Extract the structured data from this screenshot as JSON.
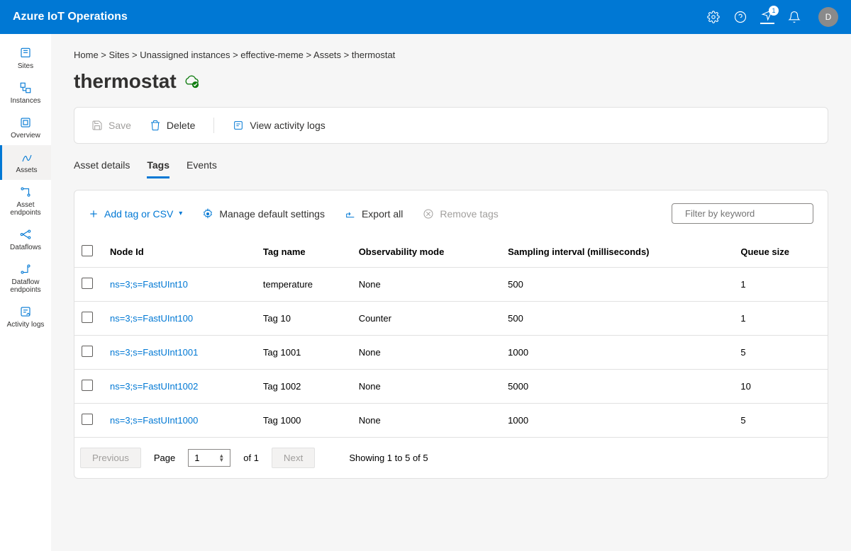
{
  "brand": "Azure IoT Operations",
  "feedbackBadge": "1",
  "avatar": "D",
  "sidebar": {
    "items": [
      {
        "label": "Sites"
      },
      {
        "label": "Instances"
      },
      {
        "label": "Overview"
      },
      {
        "label": "Assets"
      },
      {
        "label": "Asset endpoints"
      },
      {
        "label": "Dataflows"
      },
      {
        "label": "Dataflow endpoints"
      },
      {
        "label": "Activity logs"
      }
    ]
  },
  "breadcrumb": [
    "Home",
    "Sites",
    "Unassigned instances",
    "effective-meme",
    "Assets",
    "thermostat"
  ],
  "title": "thermostat",
  "toolbar": {
    "save": "Save",
    "delete": "Delete",
    "logs": "View activity logs"
  },
  "tabs": [
    "Asset details",
    "Tags",
    "Events"
  ],
  "actions": {
    "add": "Add tag or CSV",
    "manage": "Manage default settings",
    "export": "Export all",
    "remove": "Remove tags"
  },
  "search": {
    "placeholder": "Filter by keyword"
  },
  "columns": [
    "Node Id",
    "Tag name",
    "Observability mode",
    "Sampling interval (milliseconds)",
    "Queue size"
  ],
  "rows": [
    {
      "node": "ns=3;s=FastUInt10",
      "tag": "temperature",
      "obs": "None",
      "interval": "500",
      "queue": "1"
    },
    {
      "node": "ns=3;s=FastUInt100",
      "tag": "Tag 10",
      "obs": "Counter",
      "interval": "500",
      "queue": "1"
    },
    {
      "node": "ns=3;s=FastUInt1001",
      "tag": "Tag 1001",
      "obs": "None",
      "interval": "1000",
      "queue": "5"
    },
    {
      "node": "ns=3;s=FastUInt1002",
      "tag": "Tag 1002",
      "obs": "None",
      "interval": "5000",
      "queue": "10"
    },
    {
      "node": "ns=3;s=FastUInt1000",
      "tag": "Tag 1000",
      "obs": "None",
      "interval": "1000",
      "queue": "5"
    }
  ],
  "pager": {
    "prev": "Previous",
    "next": "Next",
    "pageLabel": "Page",
    "page": "1",
    "ofLabel": "of 1",
    "showing": "Showing 1 to 5 of 5"
  }
}
